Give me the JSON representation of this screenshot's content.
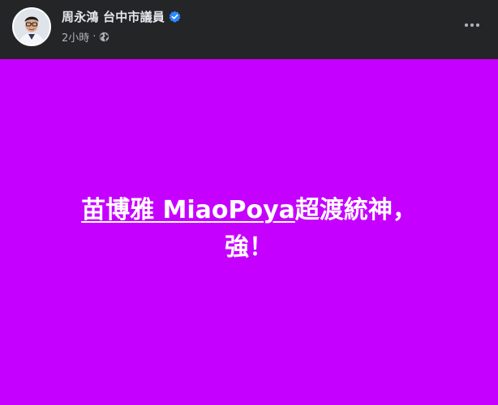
{
  "post": {
    "author": "周永鴻 台中市議員",
    "time": "2小時",
    "separator": "·",
    "verified_icon": "verified-badge-icon",
    "privacy_icon": "globe-icon",
    "menu_icon": "more-options-icon",
    "background_color": "#c600ff",
    "header_bg": "#242526",
    "verified_color": "#2d88ff"
  },
  "status": {
    "mention": "苗博雅 MiaoPoya",
    "line1_rest": "超渡統神，",
    "line2": "強！"
  }
}
